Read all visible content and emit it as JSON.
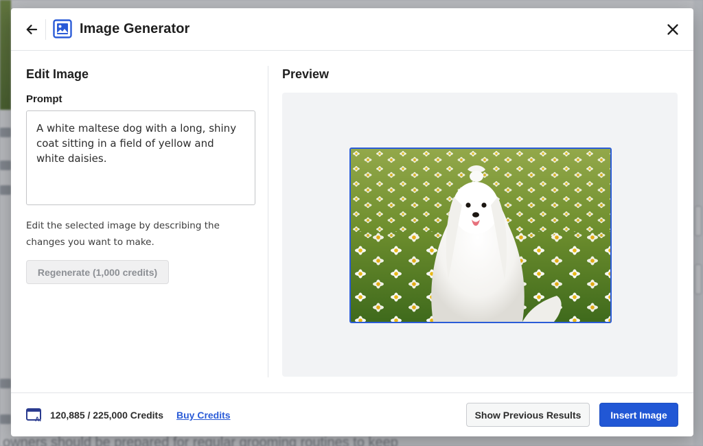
{
  "background": {
    "text_fragment": "owners should be prepared for regular grooming routines to keep"
  },
  "header": {
    "title": "Image Generator",
    "back_icon": "arrow-left-icon",
    "logo_icon": "image-icon",
    "close_icon": "close-icon"
  },
  "edit_panel": {
    "heading": "Edit Image",
    "prompt_label": "Prompt",
    "prompt_value": "A white maltese dog with a long, shiny coat sitting in a field of yellow and white daisies.",
    "helper_text": "Edit the selected image by describing the changes you want to make.",
    "regenerate_label": "Regenerate (1,000 credits)",
    "regenerate_disabled": true
  },
  "preview_panel": {
    "heading": "Preview",
    "image_alt": "white maltese dog in daisy field",
    "selected_border_color": "#2a5bd7"
  },
  "footer": {
    "credits_icon": "ai-credits-icon",
    "credits_text": "120,885 / 225,000 Credits",
    "buy_credits_label": "Buy Credits",
    "show_previous_label": "Show Previous Results",
    "insert_label": "Insert Image"
  },
  "colors": {
    "primary": "#2157d5",
    "link": "#2a5bd7",
    "text": "#1e1e1e",
    "border": "#e2e4e7"
  }
}
